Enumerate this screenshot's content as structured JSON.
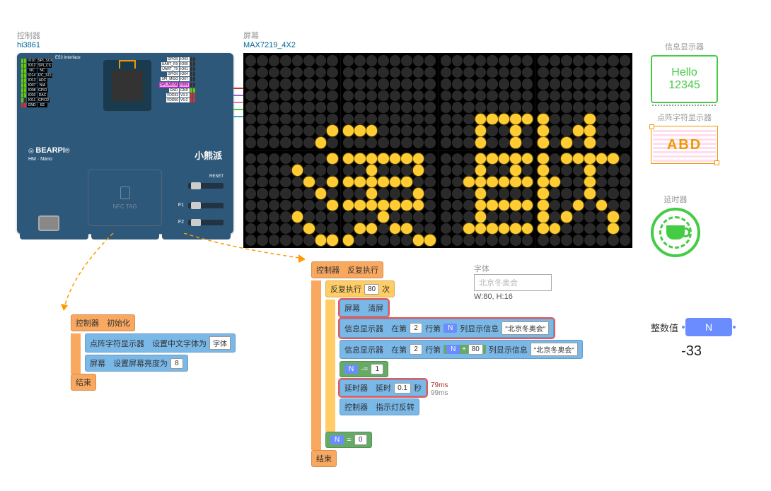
{
  "controller": {
    "label": "控制器",
    "chip": "hi3861",
    "e53": "E53   Interface",
    "right_pins": [
      "GPIO5",
      "IO03",
      "UART_RX",
      "IO00",
      "UART_TX",
      "IO01",
      "GPIO6",
      "IO04",
      "SPI_MISO",
      "IO07",
      "SPI_MOSI",
      "IO09",
      "GND",
      "GND",
      "VDD33",
      "V3.3",
      "VDD50",
      "V5.0"
    ],
    "logo": "BEARPI",
    "logo_sub": "HM · Nano",
    "nfc": "NFC TAG",
    "brand": "小熊派",
    "reset": "RESET",
    "fn": [
      "F1",
      "F2"
    ]
  },
  "screen": {
    "label": "屏幕",
    "chip": "MAX7219_4X2"
  },
  "info": {
    "label": "信息显示器",
    "line1": "Hello",
    "line2": "12345"
  },
  "dotfont": {
    "label": "点阵字符显示器",
    "sample": "ABD"
  },
  "timer": {
    "label": "延时器"
  },
  "intvar": {
    "label": "整数值",
    "name": "N",
    "value": "-33"
  },
  "font": {
    "label": "字体",
    "text": "北京冬奥会",
    "dim": "W:80, H:16"
  },
  "code1": {
    "head_l": "控制器",
    "head_r": "初始化",
    "l1a": "点阵字符显示器",
    "l1b": "设置中文字体为",
    "l1c": "字体",
    "l2a": "屏幕",
    "l2b": "设置屏幕亮度为",
    "l2v": "8",
    "end": "结束"
  },
  "code2": {
    "head_l": "控制器",
    "head_r": "反复执行",
    "loop_a": "反复执行",
    "loop_n": "80",
    "loop_b": "次",
    "r1a": "屏幕",
    "r1b": "清屏",
    "r2a": "信息显示器",
    "r2b": "在第",
    "r2v1": "2",
    "r2c": "行第",
    "r2var": "N",
    "r2d": "列显示信息",
    "r2s": "\"北京冬奥会\"",
    "r3a": "信息显示器",
    "r3b": "在第",
    "r3v1": "2",
    "r3c": "行第",
    "r3var": "N",
    "r3op": "+",
    "r3v2": "80",
    "r3d": "列显示信息",
    "r3s": "\"北京冬奥会\"",
    "r4var": "N",
    "r4op": "-=",
    "r4v": "1",
    "r5a": "延时器",
    "r5b": "延时",
    "r5v": "0.1",
    "r5c": "秒",
    "r5t1": "79ms",
    "r5t2": "99ms",
    "r6a": "控制器",
    "r6b": "指示灯反转",
    "r7var": "N",
    "r7op": "=",
    "r7v": "0",
    "end": "结束"
  },
  "led_on": [
    [
      0,
      7,
      6
    ],
    [
      0,
      8,
      6
    ],
    [
      0,
      9,
      6
    ],
    [
      0,
      10,
      6
    ],
    [
      0,
      6,
      7
    ],
    [
      0,
      7,
      8
    ],
    [
      0,
      8,
      8
    ],
    [
      0,
      9,
      8
    ],
    [
      0,
      10,
      8
    ],
    [
      0,
      11,
      8
    ],
    [
      0,
      12,
      8
    ],
    [
      0,
      13,
      8
    ],
    [
      0,
      14,
      8
    ],
    [
      0,
      10,
      9
    ],
    [
      0,
      14,
      9
    ],
    [
      0,
      4,
      9
    ],
    [
      0,
      5,
      10
    ],
    [
      0,
      7,
      10
    ],
    [
      0,
      8,
      10
    ],
    [
      0,
      9,
      10
    ],
    [
      0,
      10,
      10
    ],
    [
      0,
      11,
      10
    ],
    [
      0,
      12,
      10
    ],
    [
      0,
      13,
      10
    ],
    [
      0,
      6,
      11
    ],
    [
      0,
      10,
      11
    ],
    [
      0,
      14,
      11
    ],
    [
      0,
      7,
      12
    ],
    [
      0,
      8,
      12
    ],
    [
      0,
      9,
      12
    ],
    [
      0,
      10,
      12
    ],
    [
      0,
      11,
      12
    ],
    [
      0,
      12,
      12
    ],
    [
      0,
      13,
      12
    ],
    [
      0,
      14,
      12
    ],
    [
      0,
      4,
      13
    ],
    [
      0,
      11,
      13
    ],
    [
      0,
      5,
      14
    ],
    [
      0,
      9,
      14
    ],
    [
      0,
      10,
      14
    ],
    [
      0,
      12,
      14
    ],
    [
      0,
      13,
      14
    ],
    [
      0,
      6,
      15
    ],
    [
      0,
      7,
      15
    ],
    [
      0,
      8,
      15
    ],
    [
      0,
      14,
      15
    ],
    [
      0,
      15,
      15
    ],
    [
      0,
      19,
      5
    ],
    [
      0,
      20,
      5
    ],
    [
      0,
      21,
      5
    ],
    [
      0,
      22,
      5
    ],
    [
      0,
      23,
      5
    ],
    [
      0,
      24,
      5
    ],
    [
      0,
      28,
      5
    ],
    [
      0,
      19,
      6
    ],
    [
      0,
      22,
      6
    ],
    [
      0,
      24,
      6
    ],
    [
      0,
      27,
      6
    ],
    [
      0,
      28,
      6
    ],
    [
      0,
      19,
      7
    ],
    [
      0,
      22,
      7
    ],
    [
      0,
      24,
      7
    ],
    [
      0,
      26,
      7
    ],
    [
      0,
      28,
      7
    ],
    [
      0,
      19,
      8
    ],
    [
      0,
      20,
      8
    ],
    [
      0,
      21,
      8
    ],
    [
      0,
      22,
      8
    ],
    [
      0,
      23,
      8
    ],
    [
      0,
      24,
      8
    ],
    [
      0,
      26,
      8
    ],
    [
      0,
      27,
      8
    ],
    [
      0,
      28,
      8
    ],
    [
      0,
      29,
      8
    ],
    [
      0,
      30,
      8
    ],
    [
      0,
      19,
      9
    ],
    [
      0,
      22,
      9
    ],
    [
      0,
      24,
      9
    ],
    [
      0,
      28,
      9
    ],
    [
      0,
      18,
      10
    ],
    [
      0,
      19,
      10
    ],
    [
      0,
      20,
      10
    ],
    [
      0,
      21,
      10
    ],
    [
      0,
      22,
      10
    ],
    [
      0,
      23,
      10
    ],
    [
      0,
      24,
      10
    ],
    [
      0,
      25,
      10
    ],
    [
      0,
      28,
      10
    ],
    [
      0,
      19,
      11
    ],
    [
      0,
      24,
      11
    ],
    [
      0,
      28,
      11
    ],
    [
      0,
      19,
      12
    ],
    [
      0,
      20,
      12
    ],
    [
      0,
      21,
      12
    ],
    [
      0,
      22,
      12
    ],
    [
      0,
      23,
      12
    ],
    [
      0,
      24,
      12
    ],
    [
      0,
      27,
      12
    ],
    [
      0,
      29,
      12
    ],
    [
      0,
      19,
      13
    ],
    [
      0,
      24,
      13
    ],
    [
      0,
      26,
      13
    ],
    [
      0,
      30,
      13
    ],
    [
      0,
      18,
      14
    ],
    [
      0,
      19,
      14
    ],
    [
      0,
      20,
      14
    ],
    [
      0,
      21,
      14
    ],
    [
      0,
      22,
      14
    ],
    [
      0,
      23,
      14
    ],
    [
      0,
      24,
      14
    ],
    [
      0,
      25,
      14
    ],
    [
      0,
      30,
      14
    ]
  ],
  "chart_data": {
    "type": "table",
    "note": "LED matrix state encoded in led_on as [panel,col,row] coordinates within 32x16 grid showing Chinese characters 冬奥"
  }
}
